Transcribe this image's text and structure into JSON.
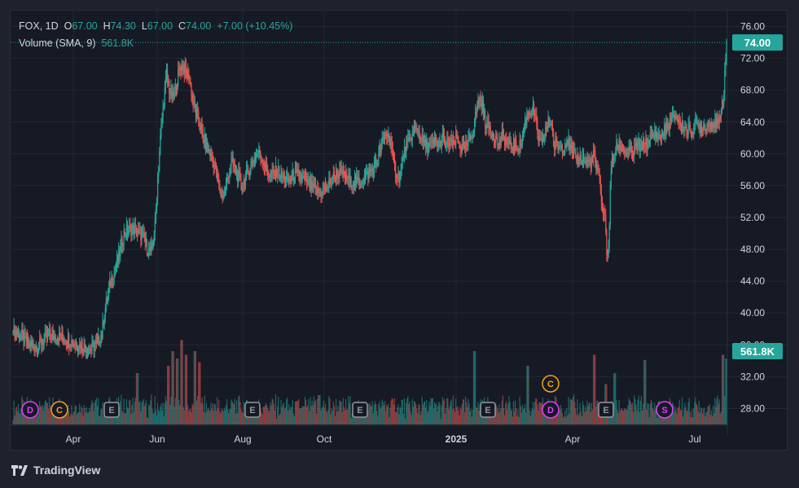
{
  "header": {
    "symbol": "FOX",
    "interval": "1D",
    "o_label": "O",
    "o_value": "67.00",
    "h_label": "H",
    "h_value": "74.30",
    "l_label": "L",
    "l_value": "67.00",
    "c_label": "C",
    "c_value": "74.00",
    "change": "+7.00 (+10.45%)",
    "volume_label": "Volume (SMA, 9)",
    "volume_value": "561.8K"
  },
  "price_badge": "74.00",
  "volume_badge": "561.8K",
  "brand": "TradingView",
  "colors": {
    "up": "#26a69a",
    "down": "#ef5350",
    "grid": "#242733",
    "text": "#d1d4dc",
    "event_orange": "#f7a21b",
    "event_pink": "#e040fb",
    "event_gray": "#9598a1"
  },
  "chart_data": {
    "type": "candlestick",
    "ylim": [
      26,
      78
    ],
    "y_ticks": [
      "76.00",
      "72.00",
      "68.00",
      "64.00",
      "60.00",
      "56.00",
      "52.00",
      "48.00",
      "44.00",
      "40.00",
      "36.00",
      "32.00",
      "28.00"
    ],
    "x_ticks": [
      "Apr",
      "Jun",
      "Aug",
      "Oct",
      "2025",
      "Apr",
      "Jul"
    ],
    "price_anchors": [
      [
        0,
        37.7
      ],
      [
        5,
        37.6
      ],
      [
        10,
        37.0
      ],
      [
        18,
        36.0
      ],
      [
        28,
        35.8
      ],
      [
        40,
        37.2
      ],
      [
        55,
        37.0
      ],
      [
        70,
        36.2
      ],
      [
        80,
        35.8
      ],
      [
        88,
        35.5
      ],
      [
        95,
        36.2
      ],
      [
        100,
        37.5
      ],
      [
        103,
        40
      ],
      [
        110,
        44
      ],
      [
        118,
        46.5
      ],
      [
        125,
        50
      ],
      [
        130,
        50.5
      ],
      [
        137,
        50.5
      ],
      [
        142,
        50.0
      ],
      [
        147,
        49.5
      ],
      [
        152,
        48.0
      ],
      [
        156,
        47.6
      ],
      [
        160,
        51
      ],
      [
        163,
        57
      ],
      [
        166,
        62
      ],
      [
        170,
        67
      ],
      [
        173,
        70
      ],
      [
        176,
        68
      ],
      [
        180,
        67
      ],
      [
        183,
        68
      ],
      [
        186,
        70
      ],
      [
        189,
        71
      ],
      [
        192,
        71
      ],
      [
        195,
        70
      ],
      [
        198,
        70
      ],
      [
        202,
        67
      ],
      [
        206,
        65
      ],
      [
        210,
        64
      ],
      [
        214,
        62
      ],
      [
        218,
        61
      ],
      [
        222,
        60
      ],
      [
        226,
        59
      ],
      [
        230,
        57
      ],
      [
        234,
        55
      ],
      [
        238,
        55
      ],
      [
        242,
        57
      ],
      [
        246,
        59
      ],
      [
        250,
        58
      ],
      [
        254,
        57
      ],
      [
        258,
        56
      ],
      [
        262,
        57
      ],
      [
        266,
        58
      ],
      [
        270,
        59
      ],
      [
        274,
        60
      ],
      [
        278,
        60
      ],
      [
        282,
        59
      ],
      [
        286,
        58
      ],
      [
        290,
        57
      ],
      [
        294,
        57.5
      ],
      [
        298,
        58
      ],
      [
        302,
        57
      ],
      [
        306,
        57
      ],
      [
        310,
        56.5
      ],
      [
        314,
        57
      ],
      [
        318,
        57.5
      ],
      [
        322,
        57
      ],
      [
        326,
        57
      ],
      [
        330,
        56.5
      ],
      [
        335,
        56
      ],
      [
        340,
        55.5
      ],
      [
        345,
        55
      ],
      [
        350,
        55.5
      ],
      [
        355,
        56
      ],
      [
        360,
        57
      ],
      [
        365,
        57.5
      ],
      [
        370,
        57.5
      ],
      [
        375,
        57
      ],
      [
        380,
        56.5
      ],
      [
        385,
        56.5
      ],
      [
        390,
        56.5
      ],
      [
        395,
        57
      ],
      [
        400,
        57.5
      ],
      [
        405,
        58
      ],
      [
        410,
        59
      ],
      [
        415,
        61
      ],
      [
        420,
        62.5
      ],
      [
        425,
        62
      ],
      [
        428,
        59
      ],
      [
        432,
        57.5
      ],
      [
        436,
        57
      ],
      [
        440,
        60
      ],
      [
        444,
        61
      ],
      [
        448,
        62
      ],
      [
        452,
        63
      ],
      [
        456,
        63
      ],
      [
        460,
        62
      ],
      [
        464,
        61
      ],
      [
        468,
        61
      ],
      [
        472,
        61
      ],
      [
        476,
        61.5
      ],
      [
        480,
        61
      ],
      [
        484,
        62
      ],
      [
        488,
        61
      ],
      [
        492,
        61.5
      ],
      [
        496,
        61
      ],
      [
        500,
        62
      ],
      [
        504,
        61
      ],
      [
        508,
        60.5
      ],
      [
        512,
        61
      ],
      [
        515,
        62
      ],
      [
        518,
        63
      ],
      [
        520,
        64
      ],
      [
        523,
        66
      ],
      [
        526,
        67
      ],
      [
        529,
        66
      ],
      [
        532,
        64
      ],
      [
        535,
        63.5
      ],
      [
        538,
        63
      ],
      [
        541,
        62.5
      ],
      [
        544,
        62
      ],
      [
        547,
        61
      ],
      [
        550,
        62
      ],
      [
        553,
        62
      ],
      [
        556,
        61.5
      ],
      [
        559,
        61
      ],
      [
        562,
        61
      ],
      [
        565,
        61
      ],
      [
        568,
        61
      ],
      [
        571,
        61
      ],
      [
        574,
        62
      ],
      [
        577,
        64
      ],
      [
        580,
        65
      ],
      [
        583,
        65.5
      ],
      [
        586,
        65.5
      ],
      [
        589,
        64
      ],
      [
        592,
        62
      ],
      [
        596,
        61
      ],
      [
        600,
        63
      ],
      [
        604,
        64
      ],
      [
        607,
        64
      ],
      [
        609,
        61
      ],
      [
        612,
        61
      ],
      [
        615,
        61
      ],
      [
        618,
        61
      ],
      [
        621,
        61
      ],
      [
        624,
        62
      ],
      [
        627,
        61
      ],
      [
        630,
        60
      ],
      [
        633,
        59.5
      ],
      [
        636,
        59.5
      ],
      [
        639,
        59.5
      ],
      [
        642,
        59.5
      ],
      [
        645,
        59
      ],
      [
        647,
        59
      ],
      [
        649,
        59
      ],
      [
        652,
        59
      ],
      [
        655,
        60
      ],
      [
        657,
        58
      ],
      [
        660,
        57
      ],
      [
        662,
        56
      ],
      [
        664,
        53
      ],
      [
        667,
        52
      ],
      [
        669,
        48
      ],
      [
        671,
        47.5
      ],
      [
        673,
        56
      ],
      [
        675,
        59
      ],
      [
        678,
        60
      ],
      [
        681,
        61
      ],
      [
        684,
        61
      ],
      [
        687,
        61
      ],
      [
        690,
        60
      ],
      [
        693,
        60.5
      ],
      [
        696,
        60
      ],
      [
        699,
        60
      ],
      [
        702,
        61
      ],
      [
        705,
        61
      ],
      [
        708,
        60.5
      ],
      [
        711,
        61.5
      ],
      [
        714,
        61
      ],
      [
        717,
        62
      ],
      [
        720,
        62
      ],
      [
        723,
        62.5
      ],
      [
        726,
        62.5
      ],
      [
        729,
        62
      ],
      [
        732,
        62.5
      ],
      [
        735,
        63
      ],
      [
        738,
        63.5
      ],
      [
        741,
        64
      ],
      [
        744,
        64.5
      ],
      [
        747,
        65
      ],
      [
        750,
        64
      ],
      [
        753,
        63.5
      ],
      [
        756,
        63.5
      ],
      [
        759,
        63
      ],
      [
        762,
        63
      ],
      [
        765,
        63
      ],
      [
        768,
        63.5
      ],
      [
        771,
        63.5
      ],
      [
        774,
        63.5
      ],
      [
        777,
        63.5
      ],
      [
        780,
        63.5
      ],
      [
        783,
        63.5
      ],
      [
        786,
        64
      ],
      [
        789,
        64
      ],
      [
        792,
        63.5
      ],
      [
        795,
        63.5
      ],
      [
        798,
        66
      ],
      [
        801,
        67.5
      ],
      [
        804,
        74
      ]
    ],
    "volume_events": [
      {
        "type": "D",
        "color": "pink"
      },
      {
        "type": "C",
        "color": "orange"
      },
      {
        "type": "E",
        "color": "gray"
      },
      {
        "type": "E",
        "color": "gray"
      },
      {
        "type": "E",
        "color": "gray"
      },
      {
        "type": "E",
        "color": "gray"
      },
      {
        "type": "C",
        "color": "orange"
      },
      {
        "type": "D",
        "color": "pink"
      },
      {
        "type": "E",
        "color": "gray"
      },
      {
        "type": "S",
        "color": "pink"
      }
    ]
  }
}
